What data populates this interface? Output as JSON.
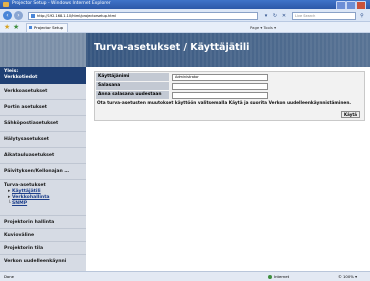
{
  "window": {
    "title": "Projector Setup - Windows Internet Explorer"
  },
  "address": {
    "url": "http://192.168.1.10/html/projectorsetup.html",
    "search_placeholder": "Live Search"
  },
  "tab": {
    "label": "Projector Setup"
  },
  "command_bar": {
    "text": "Page ▾  Tools ▾"
  },
  "sidebar": {
    "items": [
      {
        "label": "Yleis: Verkkotiedot",
        "line1": "Yleis:",
        "line2": "Verkkotiedot"
      },
      {
        "label": "Verkkoasetukset"
      },
      {
        "label": "Portin asetukset"
      },
      {
        "label": "Sähköpostiasetukset"
      },
      {
        "label": "Hälytysasetukset"
      },
      {
        "label": "Aikatauluasetukset"
      },
      {
        "label": "Päivityksen/Kellonajan …"
      },
      {
        "label": "Turva-asetukset"
      },
      {
        "label": "Projektorin hallinta"
      },
      {
        "label": "Kuvioväline"
      },
      {
        "label": "Projektorin tila"
      },
      {
        "label": "Verkon uudelleenkäynni"
      }
    ],
    "subitems": [
      {
        "label": "Käyttäjätili"
      },
      {
        "label": "Verkkohallinta"
      },
      {
        "label": "SNMP"
      }
    ]
  },
  "main": {
    "title": "Turva-asetukset / Käyttäjätili",
    "form": {
      "rows": [
        {
          "label": "Käyttäjänimi",
          "value": "Administrator"
        },
        {
          "label": "Salasana",
          "value": ""
        },
        {
          "label": "Anna salasana uudestaan",
          "value": ""
        }
      ],
      "note": "Ota turva-asetusten muutokset käyttöön valitsemalla Käytä ja suorita Verkon uudelleenkäynnistäminen.",
      "apply_label": "Käytä"
    }
  },
  "status": {
    "left": "Done",
    "zone": "Internet",
    "zoom": "© 100% ▾"
  },
  "colors": {
    "accent": "#1f3f73",
    "header": "#35557f",
    "sidebar": "#d6dbe4"
  }
}
